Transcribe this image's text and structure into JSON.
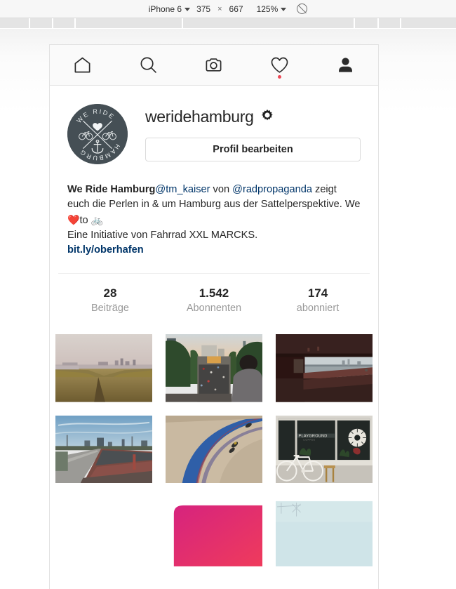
{
  "device_toolbar": {
    "device_name": "iPhone 6",
    "width": "375",
    "separator": "×",
    "height": "667",
    "zoom": "125%",
    "throttle_icon": "no-throttling-icon"
  },
  "ruler": {
    "ticks": [
      41,
      74,
      106,
      259,
      504,
      538,
      570
    ]
  },
  "navbar": {
    "items": [
      {
        "icon": "home-icon",
        "label": "Startseite",
        "active": false,
        "badge": false
      },
      {
        "icon": "search-icon",
        "label": "Suchen",
        "active": false,
        "badge": false
      },
      {
        "icon": "camera-icon",
        "label": "Kamera",
        "active": false,
        "badge": false
      },
      {
        "icon": "heart-icon",
        "label": "Aktivität",
        "active": false,
        "badge": true
      },
      {
        "icon": "person-icon",
        "label": "Profil",
        "active": true,
        "badge": false
      }
    ],
    "badge_color": "#ed4956"
  },
  "profile": {
    "avatar": {
      "icon": "we-ride-hamburg-logo",
      "background_color": "#454f55",
      "top_text": "WE RIDE",
      "bottom_text": "HAMBURG",
      "symbols": [
        "heart",
        "bicycle-left",
        "bicycle-right",
        "anchor",
        "cross"
      ]
    },
    "username": "weridehamburg",
    "settings_icon": "gear-icon",
    "edit_button_label": "Profil bearbeiten"
  },
  "bio": {
    "name": "We Ride Hamburg",
    "mention_1": "@tm_kaiser",
    "text_1": " von ",
    "mention_2": "@radpropaganda",
    "text_2": " zeigt euch die Perlen in & um Hamburg aus der Sattelperspektive. We ",
    "emoji_heart": "❤️",
    "text_3": "to ",
    "emoji_bike": "🚲",
    "text_4": "Eine Initiative von Fahrrad XXL MARCKS.",
    "url": "bit.ly/oberhafen",
    "link_color": "#003569"
  },
  "stats": [
    {
      "count": "28",
      "label": "Beiträge"
    },
    {
      "count": "1.542",
      "label": "Abonnenten"
    },
    {
      "count": "174",
      "label": "abonniert"
    }
  ],
  "grid": {
    "photos": [
      {
        "id": "photo-1",
        "description": "Elbe river marsh with golden reeds and distant Hamburg skyline at dusk"
      },
      {
        "id": "photo-2",
        "description": "Aerial view of mass cycling ride on tree-lined avenue at sunset"
      },
      {
        "id": "photo-3",
        "description": "Dark bridge underpass with view over the water and far shore"
      },
      {
        "id": "photo-4",
        "description": "Empty bridge road under blue sky with industrial skyline"
      },
      {
        "id": "photo-5",
        "description": "Cyclists riding the banked blue curve of a velodrome track"
      },
      {
        "id": "photo-6",
        "description": "White road bicycle parked in front of PLAYGROUND coffee shop window"
      },
      {
        "id": "photo-7",
        "description": "Pink gradient rounded graphic",
        "partial": true
      },
      {
        "id": "photo-8",
        "description": "Pale blue sky photo",
        "partial": true
      }
    ],
    "shop_sign_text": "PLAYGROUND"
  }
}
